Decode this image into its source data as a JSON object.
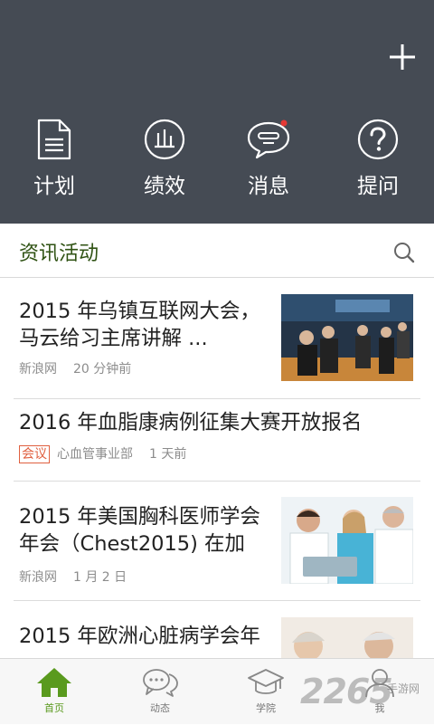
{
  "header": {
    "actions": [
      {
        "label": "计划",
        "icon": "plan-document-icon"
      },
      {
        "label": "绩效",
        "icon": "performance-chart-icon"
      },
      {
        "label": "消息",
        "icon": "message-bubble-icon"
      },
      {
        "label": "提问",
        "icon": "question-mark-icon"
      }
    ],
    "add_icon": "plus-icon",
    "background": "#454b54",
    "message_dot_color": "#e53935"
  },
  "section": {
    "title": "资讯活动",
    "search_icon": "search-icon"
  },
  "news": [
    {
      "title_line1": "2015 年乌镇互联网大会，",
      "title_line2": "马云给习主席讲解 ...",
      "source": "新浪网",
      "time": "20 分钟前",
      "has_image": true
    },
    {
      "title_line1": "2016 年血脂康病例征集大赛开放报名",
      "tag": "会议",
      "source": "心血管事业部",
      "time": "1 天前",
      "has_image": false
    },
    {
      "title_line1": "2015 年美国胸科医师学会",
      "title_line2": "年会（Chest2015) 在加",
      "source": "新浪网",
      "time": "1 月 2 日",
      "has_image": true
    },
    {
      "title_line1": "2015 年欧洲心脏病学会年",
      "has_image": true
    }
  ],
  "tabbar": {
    "tabs": [
      {
        "label": "首页",
        "icon": "home-icon",
        "active": true
      },
      {
        "label": "动态",
        "icon": "chat-bubbles-icon",
        "active": false
      },
      {
        "label": "学院",
        "icon": "graduation-cap-icon",
        "active": false
      },
      {
        "label": "我",
        "icon": "user-icon",
        "active": false
      }
    ],
    "active_color": "#5a9a1e"
  },
  "watermark": {
    "big": "2265",
    "small": "手游网"
  }
}
